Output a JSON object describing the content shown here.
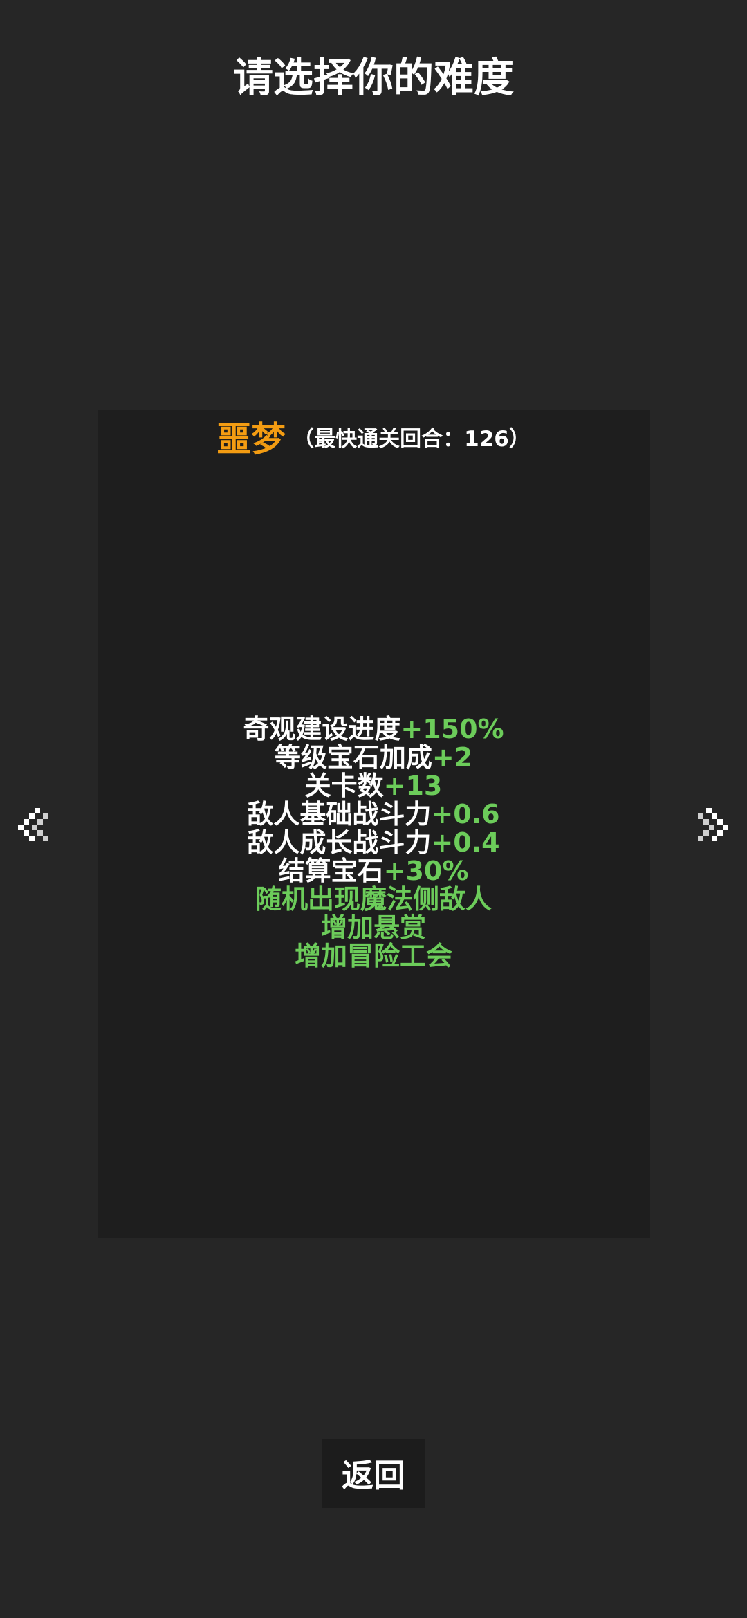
{
  "header": {
    "title": "请选择你的难度"
  },
  "difficulty": {
    "name": "噩梦",
    "best_round_text": "（最快通关回合：126）",
    "effects": [
      {
        "label": "奇观建设进度",
        "value": "+150%"
      },
      {
        "label": "等级宝石加成",
        "value": "+2"
      },
      {
        "label": "关卡数",
        "value": "+13"
      },
      {
        "label": "敌人基础战斗力",
        "value": "+0.6"
      },
      {
        "label": "敌人成长战斗力",
        "value": "+0.4"
      },
      {
        "label": "结算宝石",
        "value": "+30%"
      },
      {
        "label": "随机出现魔法侧敌人",
        "value": ""
      },
      {
        "label": "增加悬赏",
        "value": ""
      },
      {
        "label": "增加冒险工会",
        "value": ""
      }
    ]
  },
  "nav": {
    "prev_icon": "chevron-left-icon",
    "next_icon": "chevron-right-icon"
  },
  "footer": {
    "back_label": "返回"
  },
  "colors": {
    "background": "#262626",
    "card": "#1e1e1e",
    "difficulty_name": "#f39c12",
    "bonus_green": "#6ccc5a",
    "text": "#ffffff"
  }
}
